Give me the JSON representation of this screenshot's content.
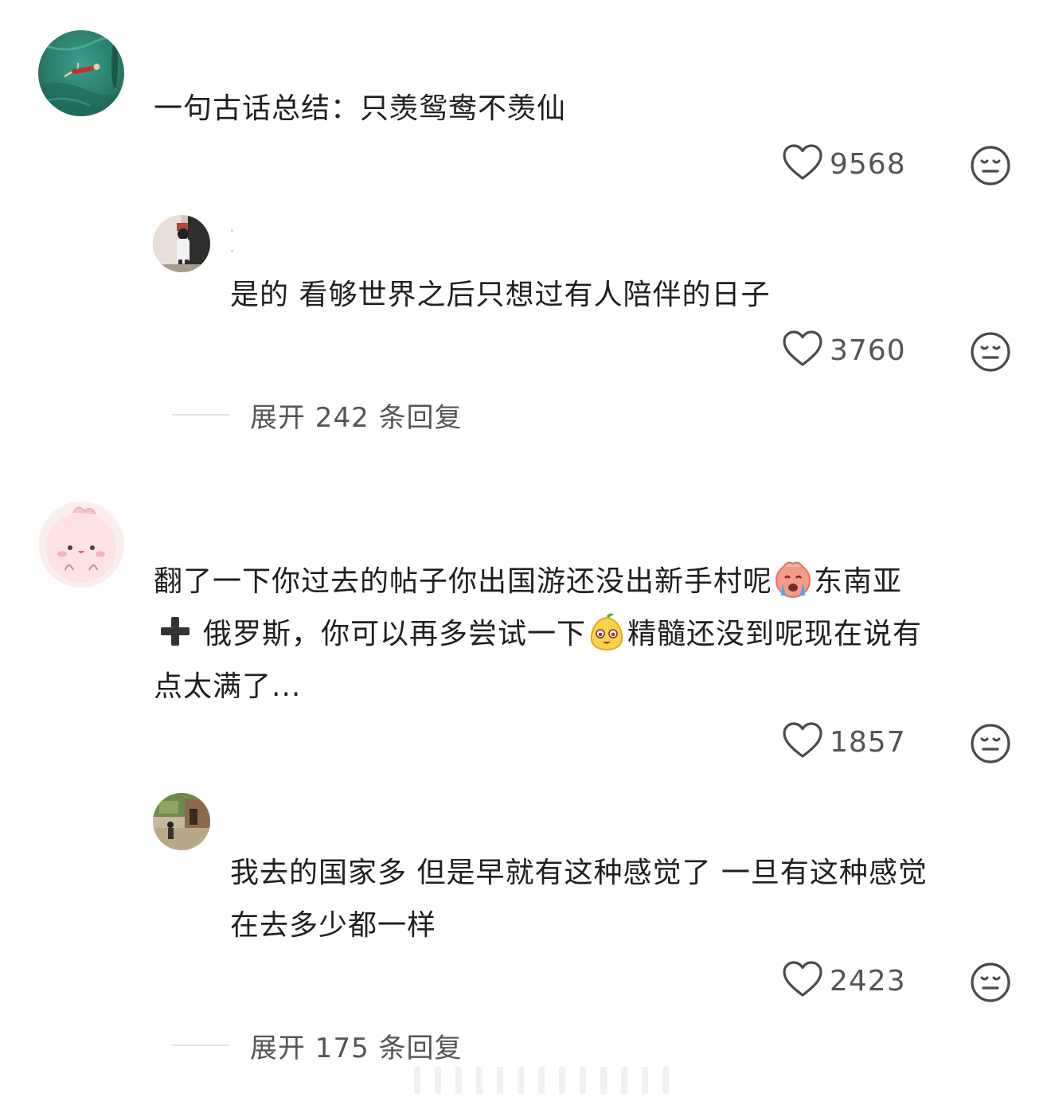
{
  "comments": [
    {
      "text_lines": [
        "一句古话总结：只羡鸳鸯不羡仙"
      ],
      "likes": "9568",
      "reply": {
        "text_lines": [
          "是的 看够世界之后只想过有人陪伴的日子"
        ],
        "likes": "3760"
      },
      "expand_label": "展开 242 条回复"
    },
    {
      "line1_a": "翻了一下你过去的帖子你出国游还没出新手村呢",
      "line1_b": "东南亚",
      "line2_a": "俄罗斯，你可以再多尝试一下",
      "line2_b": "精髓还没到呢现在说有",
      "line3": "点太满了...",
      "likes": "1857",
      "reply": {
        "text_lines": [
          "我去的国家多 但是早就有这种感觉了 一旦有这种感觉",
          "在去多少都一样"
        ],
        "likes": "2423"
      },
      "expand_label": "展开 175 条回复"
    }
  ],
  "icons": {
    "like": "heart-outline-icon",
    "dislike": "neutral-face-icon",
    "emoji_1": "crying-emoji",
    "emoji_2": "smiling-pear-emoji",
    "plus": "heavy-plus-icon"
  },
  "colors": {
    "text": "#1f1f1f",
    "muted": "#555555",
    "divider": "#e2e2e2"
  }
}
